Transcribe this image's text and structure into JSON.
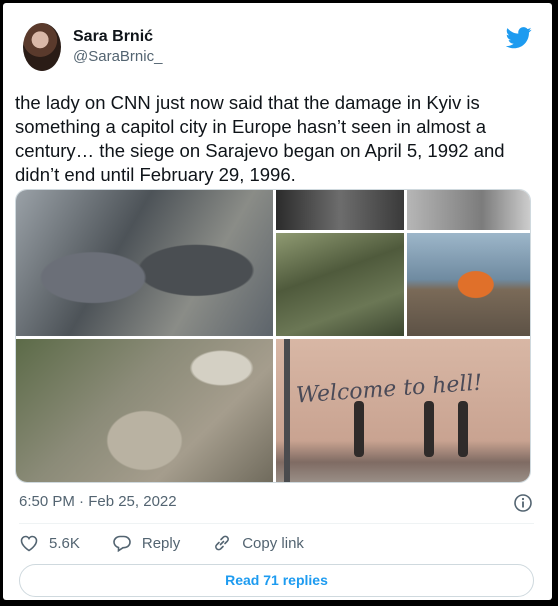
{
  "user": {
    "display_name": "Sara Brnić",
    "handle": "@SaraBrnic_"
  },
  "tweet": {
    "text": "the lady on CNN just now said that the damage in Kyiv is something a capitol city in Europe hasn’t seen in almost a century… the siege on Sarajevo began on April 5, 1992 and didn’t end until February 29, 1996.",
    "timestamp": "6:50 PM · Feb 25, 2022"
  },
  "media": {
    "graffiti_text": "Welcome to hell!"
  },
  "actions": {
    "likes": "5.6K",
    "reply_label": "Reply",
    "copy_link_label": "Copy link"
  },
  "read_replies_label": "Read 71 replies",
  "colors": {
    "accent": "#1d9bf0",
    "muted_text": "#536471"
  }
}
